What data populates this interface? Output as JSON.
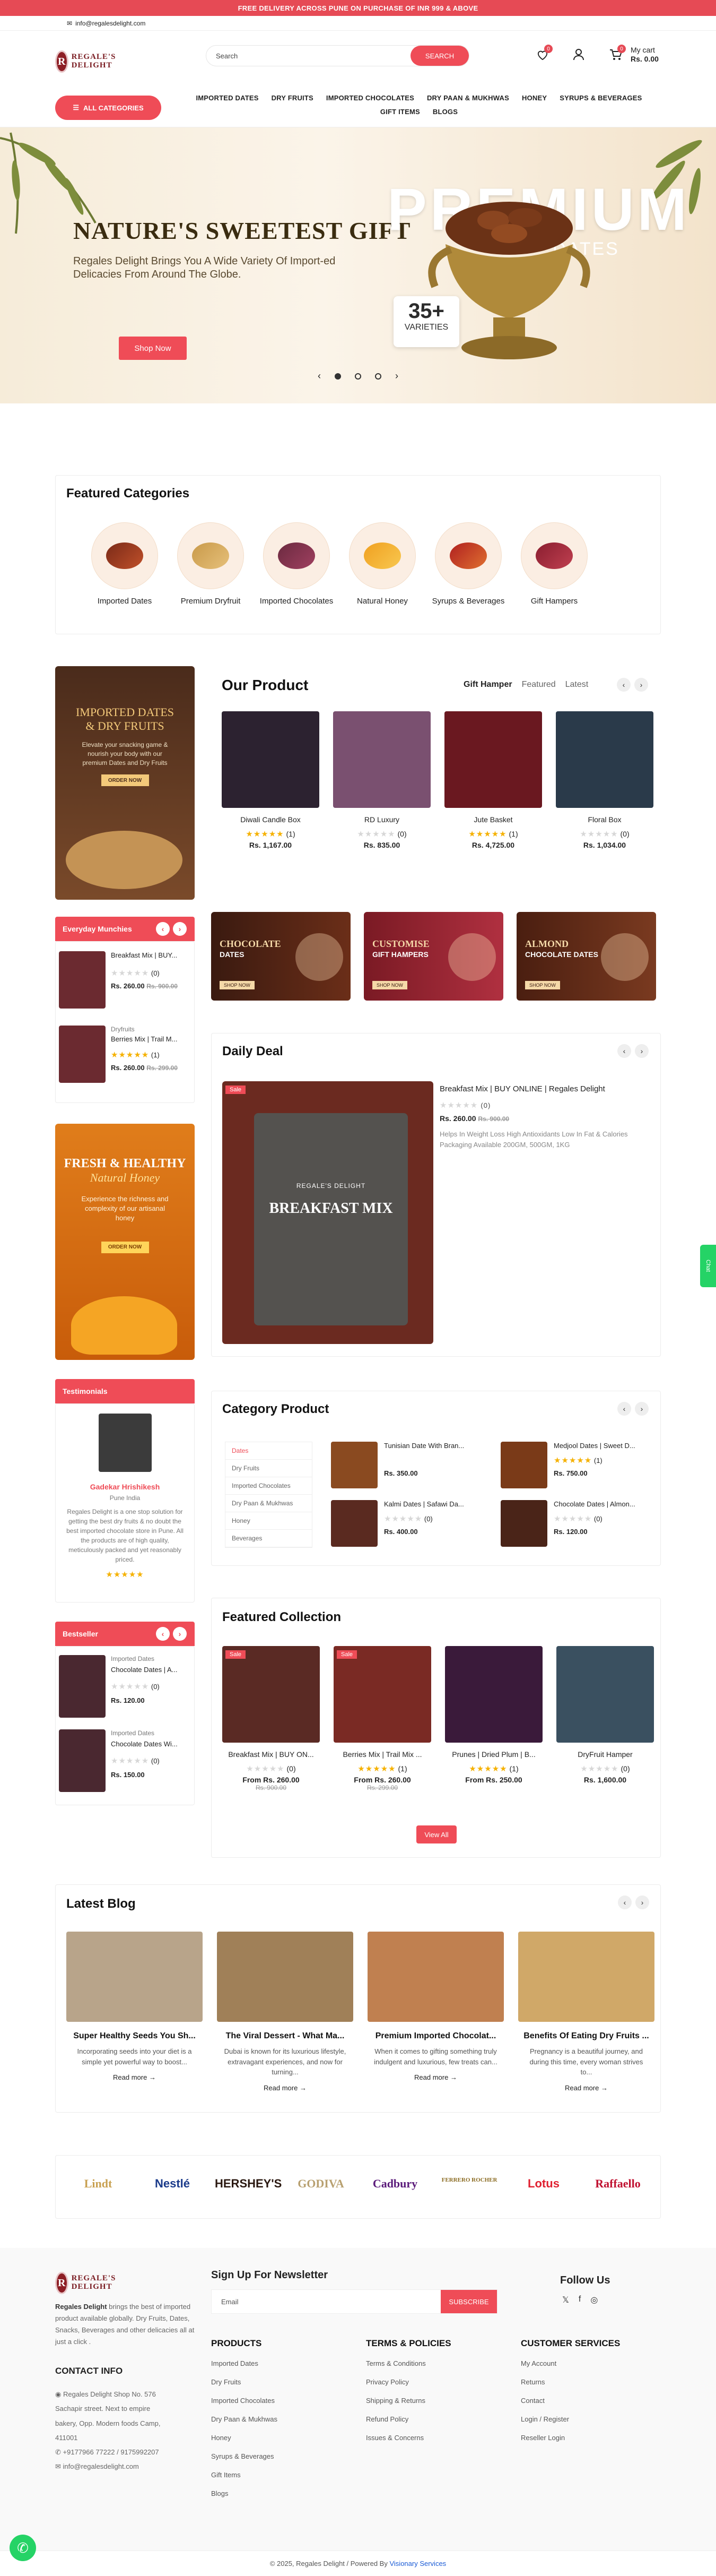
{
  "promo": "FREE DELIVERY ACROSS PUNE ON PURCHASE OF INR 999 & ABOVE",
  "email": "info@regalesdelight.com",
  "logo": {
    "mark": "R",
    "name": "REGALE'S DELIGHT"
  },
  "search": {
    "placeholder": "Search",
    "button": "SEARCH"
  },
  "wishlist_count": "0",
  "cart_count": "0",
  "cart": {
    "label": "My cart",
    "total": "Rs. 0.00"
  },
  "all_categories": "ALL CATEGORIES",
  "nav": [
    "IMPORTED DATES",
    "DRY FRUITS",
    "IMPORTED CHOCOLATES",
    "DRY PAAN & MUKHWAS",
    "HONEY",
    "SYRUPS & BEVERAGES",
    "GIFT ITEMS",
    "BLOGS"
  ],
  "hero": {
    "title": "NATURE'S SWEETEST GIFT",
    "text": "Regales Delight Brings You A Wide Variety Of Import-ed Delicacies From Around The Globe.",
    "button": "Shop Now",
    "premium": "PREMIUM",
    "dates": "DATES",
    "badge_num": "35+",
    "badge_txt": "VARIETIES"
  },
  "featured": {
    "title": "Featured Categories",
    "items": [
      "Imported Dates",
      "Premium Dryfruit",
      "Imported Chocolates",
      "Natural Honey",
      "Syrups & Beverages",
      "Gift Hampers"
    ]
  },
  "promo_left": {
    "title": "IMPORTED DATES",
    "title2": "& DRY FRUITS",
    "text": "Elevate your snacking game & nourish your body with our premium Dates and Dry Fruits",
    "button": "ORDER NOW"
  },
  "our_product": {
    "title": "Our Product",
    "tabs": [
      "Gift Hamper",
      "Featured",
      "Latest"
    ],
    "items": [
      {
        "name": "Diwali Candle Box",
        "rating": "(1)",
        "price": "Rs. 1,167.00"
      },
      {
        "name": "RD Luxury",
        "rating": "(0)",
        "price": "Rs. 835.00"
      },
      {
        "name": "Jute Basket",
        "rating": "(1)",
        "price": "Rs. 4,725.00"
      },
      {
        "name": "Floral Box",
        "rating": "(0)",
        "price": "Rs. 1,034.00"
      }
    ]
  },
  "munchies": {
    "title": "Everyday Munchies",
    "items": [
      {
        "cat": "",
        "name": "Breakfast Mix | BUY...",
        "rating": "(0)",
        "price": "Rs. 260.00",
        "old": "Rs. 900.00"
      },
      {
        "cat": "Dryfruits",
        "name": "Berries Mix | Trail M...",
        "rating": "(1)",
        "price": "Rs. 260.00",
        "old": "Rs. 299.00"
      }
    ]
  },
  "mid_banners": [
    {
      "t1": "CHOCOLATE",
      "t2": "DATES",
      "btn": "SHOP NOW"
    },
    {
      "t1": "CUSTOMISE",
      "t2": "GIFT HAMPERS",
      "btn": "SHOP NOW"
    },
    {
      "t1": "ALMOND",
      "t2": "CHOCOLATE DATES",
      "btn": "SHOP NOW"
    }
  ],
  "honey": {
    "t1": "FRESH & HEALTHY",
    "t2": "Natural Honey",
    "text": "Experience the richness and complexity of our artisanal honey",
    "btn": "ORDER NOW"
  },
  "daily": {
    "title": "Daily Deal",
    "sale": "Sale",
    "name": "Breakfast Mix | BUY ONLINE | Regales Delight",
    "rating": "(0)",
    "price": "Rs. 260.00",
    "old": "Rs. 900.00",
    "desc": "Helps In Weight Loss       High Antioxidants Low In Fat & Calories  Packaging Available 200GM, 500GM, 1KG",
    "pack_brand": "REGALE'S DELIGHT",
    "pack_title": "BREAKFAST MIX"
  },
  "testimonial": {
    "title": "Testimonials",
    "name": "Gadekar Hrishikesh",
    "place": "Pune India",
    "text": "Regales Delight is a one stop solution for getting the best dry fruits & no doubt the best imported chocolate store in Pune. All the products are of high quality, meticulously packed and yet reasonably priced."
  },
  "category_product": {
    "title": "Category Product",
    "cats": [
      "Dates",
      "Dry Fruits",
      "Imported Chocolates",
      "Dry Paan & Mukhwas",
      "Honey",
      "Beverages"
    ],
    "items": [
      {
        "name": "Tunisian Date With Bran...",
        "rating": "",
        "price": "Rs. 350.00"
      },
      {
        "name": "Medjool Dates | Sweet D...",
        "rating": "(1)",
        "price": "Rs. 750.00"
      },
      {
        "name": "Kalmi Dates | Safawi Da...",
        "rating": "(0)",
        "price": "Rs. 400.00"
      },
      {
        "name": "Chocolate Dates | Almon...",
        "rating": "(0)",
        "price": "Rs. 120.00"
      }
    ]
  },
  "bestseller": {
    "title": "Bestseller",
    "items": [
      {
        "cat": "Imported Dates",
        "name": "Chocolate Dates | A...",
        "rating": "(0)",
        "price": "Rs. 120.00"
      },
      {
        "cat": "Imported Dates",
        "name": "Chocolate Dates Wi...",
        "rating": "(0)",
        "price": "Rs. 150.00"
      }
    ]
  },
  "featured_collection": {
    "title": "Featured Collection",
    "view_all": "View All",
    "items": [
      {
        "sale": "Sale",
        "name": "Breakfast Mix | BUY ON...",
        "rating": "(0)",
        "price": "From Rs. 260.00",
        "old": "Rs. 900.00"
      },
      {
        "sale": "Sale",
        "name": "Berries Mix | Trail Mix ...",
        "rating": "(1)",
        "price": "From Rs. 260.00",
        "old": "Rs. 299.00"
      },
      {
        "sale": "",
        "name": "Prunes | Dried Plum | B...",
        "rating": "(1)",
        "price": "From Rs. 250.00",
        "old": ""
      },
      {
        "sale": "",
        "name": "DryFruit Hamper",
        "rating": "(0)",
        "price": "Rs. 1,600.00",
        "old": ""
      }
    ]
  },
  "blog": {
    "title": "Latest Blog",
    "read": "Read more →",
    "items": [
      {
        "title": "Super Healthy Seeds You Sh...",
        "text": "Incorporating seeds into your diet is a simple yet powerful way to boost..."
      },
      {
        "title": "The Viral Dessert - What Ma...",
        "text": "Dubai is known for its luxurious lifestyle, extravagant experiences, and now for turning..."
      },
      {
        "title": "Premium Imported Chocolat...",
        "text": "When it comes to gifting something truly indulgent and luxurious, few treats can..."
      },
      {
        "title": "Benefits Of Eating Dry Fruits ...",
        "text": "Pregnancy is a beautiful journey, and during this time, every woman strives to..."
      }
    ]
  },
  "brands": [
    "Lindt",
    "Nestlé",
    "HERSHEY'S",
    "GODIVA",
    "Cadbury",
    "FERRERO ROCHER",
    "Lotus",
    "Raffaello"
  ],
  "footer": {
    "about_brand": "Regales Delight",
    "about": "brings the best of imported product available globally. Dry Fruits, Dates, Snacks, Beverages and other delicacies all at just a click .",
    "contact_title": "CONTACT INFO",
    "address": "Regales Delight Shop No. 576 Sachapir street. Next to empire bakery, Opp. Modern foods Camp, 411001",
    "phone": "+9177966 77222 / 9175992207",
    "mail": "info@regalesdelight.com",
    "newsletter": "Sign Up For Newsletter",
    "email_placeholder": "Email",
    "subscribe": "SUBSCRIBE",
    "follow": "Follow Us",
    "products_title": "PRODUCTS",
    "products": [
      "Imported Dates",
      "Dry Fruits",
      "Imported Chocolates",
      "Dry Paan & Mukhwas",
      "Honey",
      "Syrups & Beverages",
      "Gift Items",
      "Blogs"
    ],
    "terms_title": "TERMS & POLICIES",
    "terms": [
      "Terms & Conditions",
      "Privacy Policy",
      "Shipping & Returns",
      "Refund Policy",
      "Issues & Concerns"
    ],
    "service_title": "CUSTOMER SERVICES",
    "service": [
      "My Account",
      "Returns",
      "Contact",
      "Login / Register",
      "Reseller Login"
    ],
    "copyright": "© 2025, Regales Delight / Powered By ",
    "powered": "Visionary Services"
  },
  "chat_tab": "Chat"
}
